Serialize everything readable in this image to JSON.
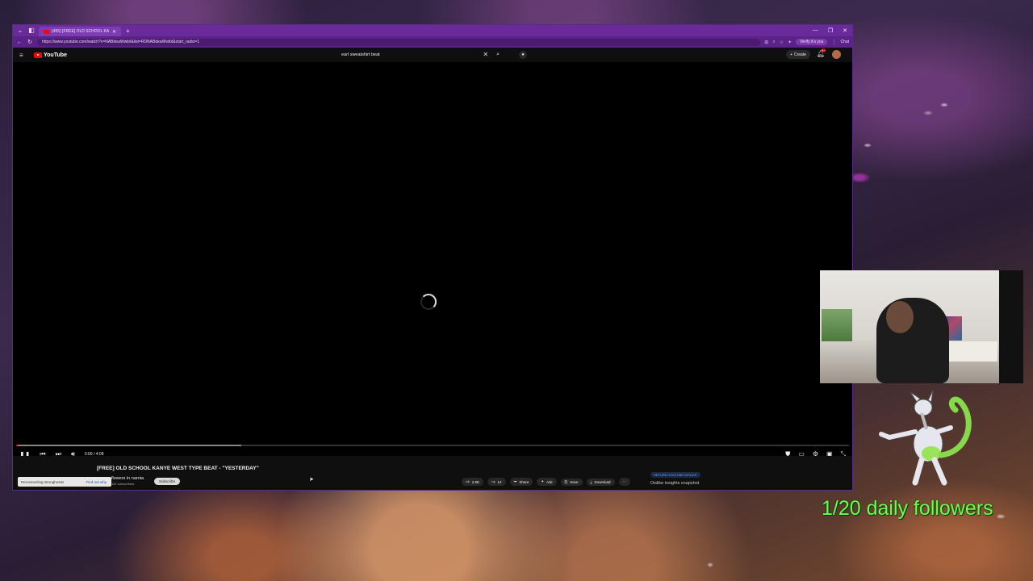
{
  "browser": {
    "tab_title": "(465) [FREE] OLD SCHOOL KA",
    "url": "https://www.youtube.com/watch?v=NABdeaWwibI&list=RDNABdeaWwibI&start_radio=1",
    "verify_label": "Verify it's you",
    "chat_label": "Chat"
  },
  "youtube": {
    "logo_text": "YouTube",
    "search_value": "earl sweatshirt beat",
    "create_label": "Create",
    "notification_count": "9+"
  },
  "player": {
    "time": "0:00 / 4:08",
    "buffered_fraction": 0.27,
    "played_fraction": 0.0
  },
  "video": {
    "title": "[FREE] OLD SCHOOL KANYE WEST TYPE BEAT - \"YESTERDAY\"",
    "channel": "flowers in narnia",
    "subscribers": "11K subscribers",
    "subscribe_label": "Subscribe",
    "likes": "2.8K",
    "dislikes": "14",
    "share_label": "Share",
    "ask_label": "Ask",
    "save_label": "Save",
    "download_label": "Download",
    "ryd_badge": "RETURN YOUTUBE DISLIKE",
    "dislike_snapshot": "Dislike insights snapshot"
  },
  "toast": {
    "text": "Reconnecting stronghosts!",
    "action": "Find out why"
  },
  "overlay": {
    "followers_text": "1/20 daily followers"
  }
}
